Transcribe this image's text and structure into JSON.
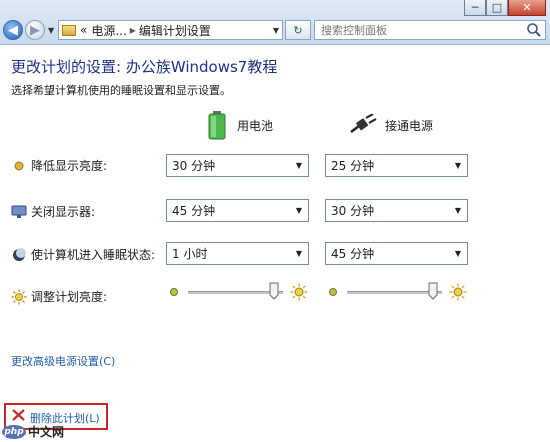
{
  "window": {
    "minimize_glyph": "─",
    "maximize_glyph": "□",
    "close_glyph": "✕"
  },
  "nav": {
    "breadcrumb_prefix": "«",
    "breadcrumb_parent": "电源...",
    "breadcrumb_sep": "▸",
    "breadcrumb_current": "编辑计划设置",
    "search_placeholder": "搜索控制面板"
  },
  "page": {
    "title": "更改计划的设置: 办公族Windows7教程",
    "subtitle": "选择希望计算机使用的睡眠设置和显示设置。"
  },
  "columns": {
    "battery_label": "用电池",
    "plugged_label": "接通电源"
  },
  "settings": [
    {
      "label": "降低显示亮度:",
      "icon": "dim-brightness-icon",
      "battery": "30 分钟",
      "plugged": "25 分钟"
    },
    {
      "label": "关闭显示器:",
      "icon": "monitor-off-icon",
      "battery": "45 分钟",
      "plugged": "30 分钟"
    },
    {
      "label": "使计算机进入睡眠状态:",
      "icon": "sleep-moon-icon",
      "battery": "1 小时",
      "plugged": "45 分钟"
    }
  ],
  "brightness": {
    "label": "调整计划亮度:",
    "battery_level": 0.9,
    "plugged_level": 0.9
  },
  "links": {
    "advanced": "更改高级电源设置(C)",
    "delete": "删除此计划(L)"
  },
  "watermark": {
    "logo": "php",
    "text": "中文网"
  },
  "colors": {
    "title": "#1e3287",
    "link": "#1f5fa8",
    "highlight_border": "#c8282a"
  }
}
